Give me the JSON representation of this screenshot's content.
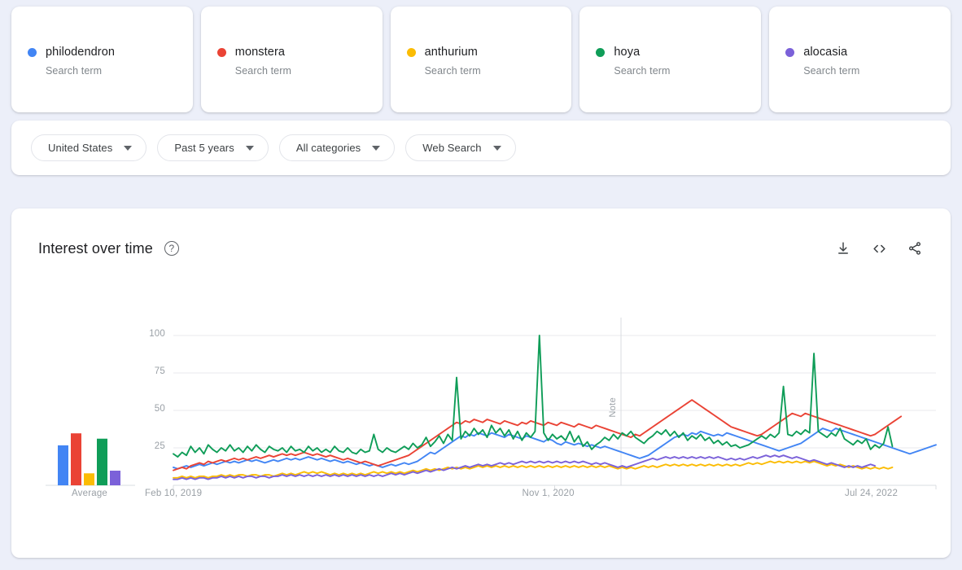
{
  "terms": [
    {
      "name": "philodendron",
      "subtitle": "Search term",
      "color": "#4285F4"
    },
    {
      "name": "monstera",
      "subtitle": "Search term",
      "color": "#EA4335"
    },
    {
      "name": "anthurium",
      "subtitle": "Search term",
      "color": "#FBBC04"
    },
    {
      "name": "hoya",
      "subtitle": "Search term",
      "color": "#0F9D58"
    },
    {
      "name": "alocasia",
      "subtitle": "Search term",
      "color": "#7B61D9"
    }
  ],
  "filters": [
    {
      "label": "United States",
      "icon": "chevron-down-icon"
    },
    {
      "label": "Past 5 years",
      "icon": "chevron-down-icon"
    },
    {
      "label": "All categories",
      "icon": "chevron-down-icon"
    },
    {
      "label": "Web Search",
      "icon": "chevron-down-icon"
    }
  ],
  "panel": {
    "title": "Interest over time",
    "help_glyph": "?",
    "actions": [
      {
        "name": "download-icon",
        "label": "Download CSV"
      },
      {
        "name": "embed-code-icon",
        "label": "Embed"
      },
      {
        "name": "share-icon",
        "label": "Share"
      }
    ]
  },
  "chart_data": {
    "type": "line",
    "title": "Interest over time",
    "xlabel": "",
    "ylabel": "",
    "ylim": [
      0,
      100
    ],
    "yticks": [
      25,
      50,
      75,
      100
    ],
    "xticks": [
      "Feb 10, 2019",
      "Nov 1, 2020",
      "Jul 24, 2022"
    ],
    "grid": true,
    "legend_position": "top-cards",
    "annotations": [
      {
        "label": "Note",
        "x_fraction": 0.587,
        "orientation": "vertical"
      }
    ],
    "average_bars": {
      "label": "Average",
      "categories": [
        "philodendron",
        "monstera",
        "anthurium",
        "hoya",
        "alocasia"
      ],
      "values": [
        30,
        39,
        9,
        35,
        11
      ]
    },
    "series": [
      {
        "name": "philodendron",
        "color": "#4285F4",
        "values": [
          12,
          11,
          12,
          13,
          12,
          13,
          14,
          13,
          14,
          15,
          14,
          15,
          16,
          15,
          16,
          15,
          16,
          17,
          16,
          17,
          16,
          15,
          16,
          17,
          16,
          17,
          18,
          17,
          18,
          17,
          18,
          19,
          18,
          17,
          18,
          17,
          16,
          17,
          16,
          15,
          16,
          15,
          14,
          15,
          14,
          13,
          14,
          13,
          12,
          13,
          14,
          13,
          14,
          15,
          14,
          15,
          16,
          18,
          20,
          22,
          21,
          23,
          25,
          27,
          29,
          31,
          33,
          32,
          34,
          33,
          35,
          34,
          33,
          35,
          34,
          33,
          32,
          34,
          33,
          32,
          31,
          33,
          32,
          31,
          30,
          29,
          31,
          30,
          28,
          27,
          29,
          28,
          27,
          28,
          27,
          26,
          27,
          26,
          25,
          26,
          25,
          24,
          23,
          22,
          21,
          20,
          19,
          18,
          19,
          20,
          22,
          24,
          26,
          28,
          30,
          32,
          33,
          34,
          33,
          35,
          34,
          36,
          35,
          34,
          33,
          34,
          33,
          35,
          34,
          33,
          32,
          31,
          30,
          29,
          28,
          27,
          26,
          25,
          24,
          23,
          24,
          25,
          26,
          27,
          28,
          30,
          32,
          34,
          36,
          38,
          37,
          36,
          38,
          37,
          36,
          35,
          34,
          33,
          32,
          31,
          30,
          29,
          28,
          27,
          26,
          25,
          24,
          23,
          22,
          21,
          22,
          23,
          24,
          25,
          26,
          27
        ]
      },
      {
        "name": "monstera",
        "color": "#EA4335",
        "values": [
          10,
          11,
          12,
          11,
          13,
          14,
          15,
          14,
          16,
          15,
          16,
          17,
          16,
          17,
          18,
          17,
          18,
          17,
          18,
          19,
          18,
          19,
          20,
          19,
          20,
          21,
          20,
          21,
          20,
          21,
          22,
          21,
          20,
          21,
          20,
          19,
          20,
          19,
          18,
          17,
          18,
          17,
          16,
          15,
          16,
          15,
          14,
          13,
          14,
          15,
          16,
          17,
          18,
          19,
          20,
          22,
          24,
          26,
          28,
          30,
          32,
          34,
          36,
          38,
          40,
          42,
          41,
          43,
          42,
          44,
          43,
          42,
          44,
          43,
          42,
          41,
          43,
          42,
          41,
          40,
          42,
          41,
          43,
          42,
          41,
          40,
          42,
          41,
          40,
          42,
          41,
          40,
          39,
          41,
          40,
          39,
          38,
          40,
          39,
          38,
          37,
          36,
          35,
          34,
          33,
          32,
          34,
          33,
          35,
          37,
          39,
          41,
          43,
          45,
          47,
          49,
          51,
          53,
          55,
          57,
          55,
          53,
          51,
          49,
          47,
          45,
          43,
          41,
          39,
          38,
          37,
          36,
          35,
          34,
          33,
          34,
          36,
          38,
          40,
          42,
          44,
          46,
          48,
          47,
          46,
          48,
          47,
          46,
          45,
          44,
          43,
          42,
          41,
          40,
          39,
          38,
          37,
          36,
          35,
          34,
          33,
          34,
          36,
          38,
          40,
          42,
          44,
          46
        ]
      },
      {
        "name": "anthurium",
        "color": "#FBBC04",
        "values": [
          5,
          5,
          6,
          5,
          6,
          5,
          6,
          6,
          5,
          6,
          6,
          7,
          6,
          7,
          6,
          7,
          7,
          6,
          7,
          7,
          6,
          7,
          7,
          6,
          7,
          8,
          7,
          8,
          7,
          8,
          9,
          8,
          9,
          8,
          9,
          8,
          7,
          8,
          7,
          8,
          7,
          8,
          7,
          8,
          7,
          8,
          9,
          8,
          9,
          8,
          9,
          8,
          9,
          8,
          9,
          10,
          9,
          10,
          11,
          10,
          11,
          10,
          11,
          12,
          11,
          12,
          11,
          12,
          11,
          12,
          13,
          12,
          13,
          12,
          13,
          12,
          13,
          12,
          13,
          12,
          13,
          12,
          13,
          12,
          13,
          12,
          13,
          12,
          13,
          12,
          13,
          12,
          13,
          12,
          13,
          12,
          13,
          12,
          13,
          12,
          13,
          12,
          11,
          12,
          11,
          12,
          11,
          12,
          13,
          12,
          13,
          12,
          13,
          14,
          13,
          14,
          13,
          14,
          13,
          14,
          13,
          14,
          13,
          14,
          13,
          14,
          13,
          14,
          13,
          14,
          13,
          14,
          15,
          14,
          15,
          14,
          15,
          16,
          15,
          16,
          15,
          16,
          15,
          16,
          15,
          16,
          15,
          16,
          15,
          14,
          13,
          14,
          13,
          14,
          13,
          12,
          13,
          12,
          11,
          12,
          11,
          12,
          11,
          12,
          11,
          12
        ]
      },
      {
        "name": "hoya",
        "color": "#0F9D58",
        "values": [
          21,
          19,
          22,
          20,
          26,
          22,
          25,
          21,
          27,
          24,
          22,
          25,
          23,
          27,
          23,
          25,
          22,
          26,
          23,
          27,
          24,
          22,
          26,
          24,
          23,
          25,
          22,
          26,
          23,
          24,
          22,
          26,
          23,
          25,
          22,
          24,
          22,
          26,
          23,
          22,
          25,
          22,
          21,
          24,
          22,
          23,
          34,
          24,
          22,
          25,
          23,
          22,
          24,
          26,
          24,
          28,
          25,
          27,
          32,
          26,
          29,
          33,
          28,
          34,
          30,
          72,
          31,
          36,
          33,
          38,
          34,
          37,
          32,
          40,
          35,
          38,
          33,
          37,
          31,
          36,
          30,
          35,
          32,
          36,
          100,
          35,
          30,
          34,
          31,
          33,
          30,
          36,
          29,
          33,
          26,
          29,
          24,
          27,
          29,
          32,
          30,
          34,
          31,
          35,
          33,
          36,
          32,
          30,
          28,
          31,
          33,
          36,
          34,
          37,
          33,
          36,
          32,
          35,
          30,
          33,
          31,
          34,
          30,
          32,
          28,
          30,
          27,
          29,
          26,
          27,
          25,
          26,
          27,
          29,
          31,
          33,
          31,
          34,
          32,
          35,
          66,
          34,
          33,
          36,
          34,
          37,
          35,
          88,
          36,
          34,
          32,
          35,
          33,
          38,
          31,
          29,
          27,
          30,
          28,
          31,
          24,
          27,
          25,
          28,
          39,
          26
        ]
      },
      {
        "name": "alocasia",
        "color": "#7B61D9",
        "values": [
          4,
          4,
          5,
          4,
          5,
          4,
          5,
          5,
          4,
          5,
          5,
          6,
          5,
          6,
          5,
          6,
          5,
          6,
          6,
          5,
          6,
          6,
          5,
          6,
          6,
          7,
          6,
          7,
          6,
          7,
          6,
          7,
          6,
          7,
          6,
          7,
          6,
          7,
          6,
          7,
          6,
          7,
          6,
          7,
          6,
          7,
          6,
          7,
          6,
          7,
          8,
          7,
          8,
          7,
          8,
          9,
          8,
          9,
          10,
          9,
          10,
          11,
          10,
          11,
          12,
          11,
          12,
          13,
          12,
          13,
          14,
          13,
          14,
          13,
          14,
          15,
          14,
          15,
          14,
          15,
          16,
          15,
          16,
          15,
          16,
          15,
          16,
          15,
          16,
          15,
          16,
          15,
          16,
          15,
          16,
          15,
          14,
          15,
          14,
          15,
          14,
          13,
          12,
          13,
          12,
          13,
          14,
          15,
          16,
          17,
          18,
          17,
          18,
          19,
          18,
          19,
          18,
          19,
          18,
          19,
          18,
          19,
          18,
          19,
          18,
          19,
          18,
          17,
          18,
          17,
          18,
          17,
          18,
          19,
          18,
          19,
          20,
          19,
          20,
          19,
          20,
          19,
          18,
          19,
          18,
          17,
          16,
          17,
          16,
          15,
          14,
          15,
          14,
          13,
          12,
          13,
          12,
          13,
          12,
          13,
          14,
          13
        ]
      }
    ]
  }
}
